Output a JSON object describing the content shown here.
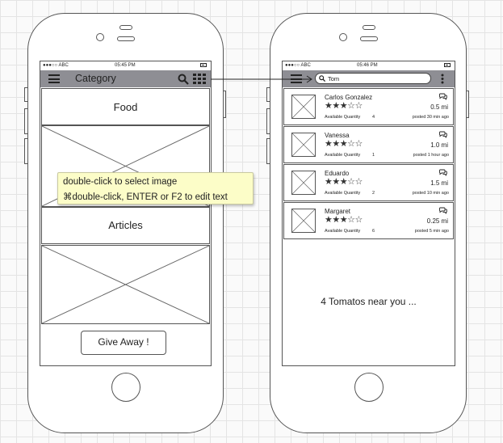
{
  "left_phone": {
    "status_bar": {
      "carrier": "●●●○○ ABC",
      "time": "05:45 PM"
    },
    "nav": {
      "title": "Category"
    },
    "sections": [
      {
        "label": "Food"
      },
      {
        "label": "Articles"
      }
    ],
    "give_away_label": "Give Away !"
  },
  "tooltip": {
    "line1": "double-click to select image",
    "line2": "⌘double-click, ENTER or F2 to edit text"
  },
  "right_phone": {
    "status_bar": {
      "carrier": "●●●○○ ABC",
      "time": "05:46 PM"
    },
    "search": {
      "value": "Tom"
    },
    "list_items": [
      {
        "name": "Carlos Gonzalez",
        "rating": 3,
        "rating_max": 5,
        "quantity_label": "Available Quantity",
        "quantity": "4",
        "distance": "0.5 mi",
        "posted": "posted 30 min ago"
      },
      {
        "name": "Vanessa",
        "rating": 3,
        "rating_max": 5,
        "quantity_label": "Available Quantity",
        "quantity": "1",
        "distance": "1.0 mi",
        "posted": "posted 1 hour ago"
      },
      {
        "name": "Eduardo",
        "rating": 3,
        "rating_max": 5,
        "quantity_label": "Available Quantity",
        "quantity": "2",
        "distance": "1.5 mi",
        "posted": "posted 10 min ago"
      },
      {
        "name": "Margaret",
        "rating": 3,
        "rating_max": 5,
        "quantity_label": "Available Quantity",
        "quantity": "6",
        "distance": "0.25 mi",
        "posted": "posted 5 min ago"
      }
    ],
    "summary": "4 Tomatos near you ..."
  },
  "icons": {
    "menu": "hamburger-menu-icon",
    "search": "search-icon",
    "grid": "grid-icon",
    "more": "more-vertical-icon",
    "chat": "chat-bubbles-icon",
    "image": "image-placeholder-icon"
  },
  "colors": {
    "navbar": "#8e8e94",
    "tooltip_bg": "#fcfdc8"
  }
}
